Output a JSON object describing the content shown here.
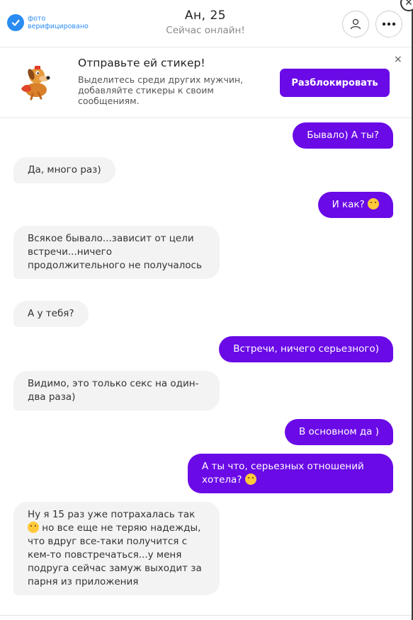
{
  "header": {
    "verified_label": "фото верифицировано",
    "name": "Ан, 25",
    "status": "Сейчас онлайн!"
  },
  "promo": {
    "title": "Отправьте ей стикер!",
    "description": "Выделитесь среди других мужчин, добавляйте стикеры к своим сообщениям.",
    "button_label": "Разблокировать",
    "close_label": "×"
  },
  "messages": [
    {
      "side": "out",
      "text": "Бывало) А ты?"
    },
    {
      "side": "in",
      "text": "Да, много раз)"
    },
    {
      "side": "out",
      "text": "И как?",
      "emoji": "wink"
    },
    {
      "side": "in",
      "text": "Всякое бывало...зависит от цели встречи...ничего продолжительного не получалось"
    },
    {
      "side": "in",
      "text": "А у тебя?"
    },
    {
      "side": "out",
      "text": "Встречи, ничего серьезного)"
    },
    {
      "side": "in",
      "text": "Видимо, это только секс на один-два раза)"
    },
    {
      "side": "out",
      "text": "В основном да )"
    },
    {
      "side": "out",
      "text": "А ты что, серьезных отношений хотела?",
      "emoji": "tears-of-joy"
    },
    {
      "side": "in",
      "text_before": "Ну я 15 раз уже потрахалась так",
      "emoji": "grin",
      "text_after": "но все еще не теряю надежды, что вдруг все-таки получится с кем-то повстречаться...у меня подруга сейчас замуж выходит за парня из приложения"
    }
  ],
  "colors": {
    "accent": "#6a0ae6",
    "verified": "#2a8cf2",
    "incoming_bubble": "#f3f3f3"
  }
}
